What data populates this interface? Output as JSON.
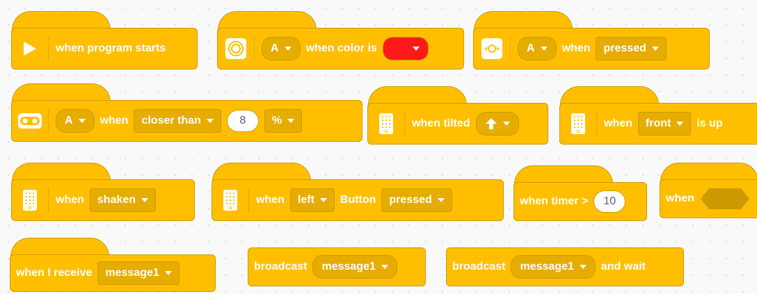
{
  "blocks": {
    "program_start": {
      "label": "when program starts"
    },
    "color": {
      "port": "A",
      "label": "when color is",
      "color_value": "#ff1a1a"
    },
    "force": {
      "port": "A",
      "when": "when",
      "state": "pressed"
    },
    "distance": {
      "port": "A",
      "when": "when",
      "condition": "closer than",
      "value": "8",
      "unit": "%"
    },
    "tilted": {
      "label": "when tilted"
    },
    "face_up": {
      "when": "when",
      "face": "front",
      "is_up": "is up"
    },
    "shaken": {
      "when": "when",
      "gesture": "shaken"
    },
    "button": {
      "when": "when",
      "side": "left",
      "button": "Button",
      "state": "pressed"
    },
    "timer": {
      "label": "when timer >",
      "value": "10"
    },
    "when_bool": {
      "when": "when"
    },
    "receive": {
      "label": "when I receive",
      "message": "message1"
    },
    "broadcast": {
      "label": "broadcast",
      "message": "message1"
    },
    "broadcast_wait": {
      "label": "broadcast",
      "message": "message1",
      "suffix": "and wait"
    }
  },
  "colors": {
    "block": "#ffbf00",
    "block_dark": "#e6ac00",
    "border": "#cc9900"
  }
}
